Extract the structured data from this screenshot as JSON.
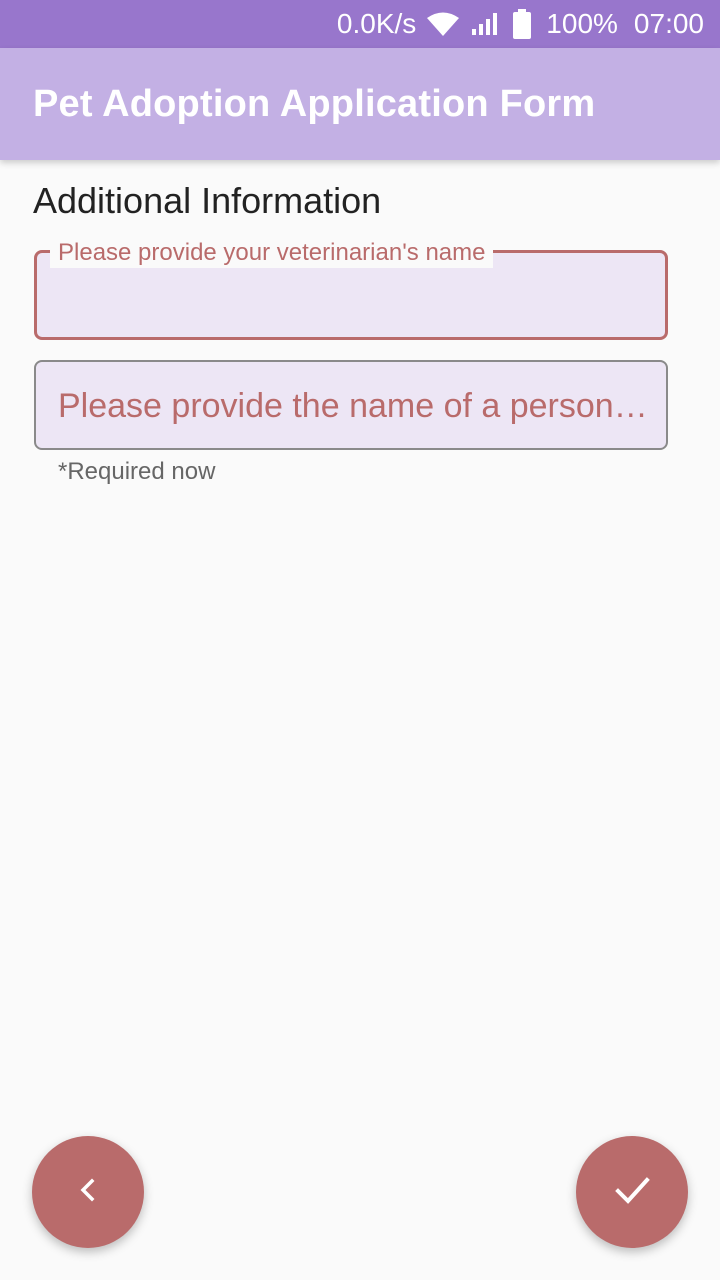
{
  "status_bar": {
    "network_speed": "0.0K/s",
    "battery_percent": "100%",
    "time": "07:00",
    "icons": [
      "wifi-icon",
      "signal-icon",
      "battery-icon"
    ]
  },
  "app_bar": {
    "title": "Pet Adoption Application Form"
  },
  "form": {
    "section_title": "Additional Information",
    "vet_field": {
      "label": "Please provide your veterinarian's name",
      "value": ""
    },
    "reference_field": {
      "placeholder": "Please provide the name of a person…",
      "value": "",
      "helper_text": "*Required now"
    }
  },
  "actions": {
    "back_icon": "chevron-left-icon",
    "submit_icon": "check-icon"
  },
  "colors": {
    "status_bar": "#9876cc",
    "app_bar": "#c3b0e4",
    "accent": "#b96b6b",
    "field_fill": "#ede6f5",
    "background": "#fafafa"
  }
}
